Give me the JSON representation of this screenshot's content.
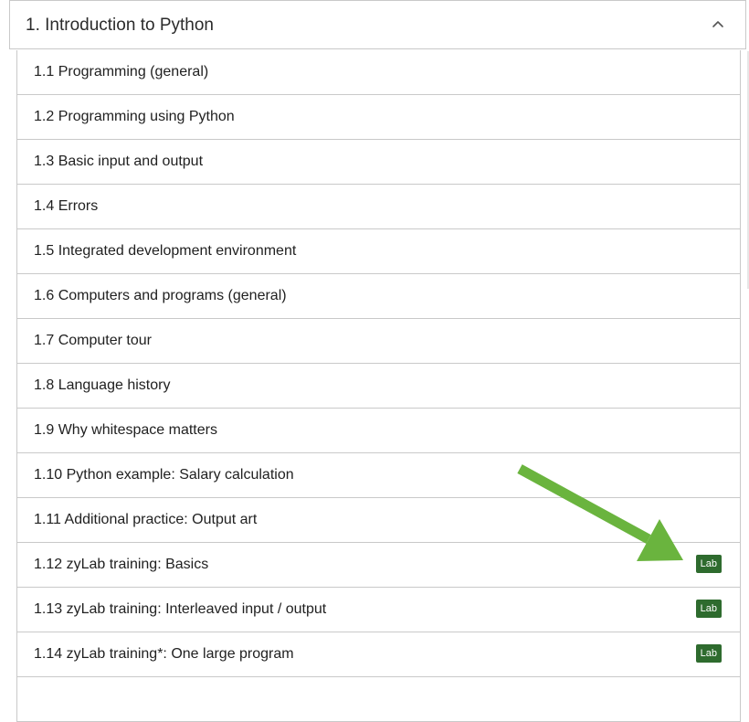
{
  "chapter": {
    "title": "1. Introduction to Python",
    "expanded": true,
    "toggle_icon": "chevron-up-icon"
  },
  "sections": [
    {
      "label": "1.1 Programming (general)",
      "badge": ""
    },
    {
      "label": "1.2 Programming using Python",
      "badge": ""
    },
    {
      "label": "1.3 Basic input and output",
      "badge": ""
    },
    {
      "label": "1.4 Errors",
      "badge": ""
    },
    {
      "label": "1.5 Integrated development environment",
      "badge": ""
    },
    {
      "label": "1.6 Computers and programs (general)",
      "badge": ""
    },
    {
      "label": "1.7 Computer tour",
      "badge": ""
    },
    {
      "label": "1.8 Language history",
      "badge": ""
    },
    {
      "label": "1.9 Why whitespace matters",
      "badge": ""
    },
    {
      "label": "1.10 Python example: Salary calculation",
      "badge": ""
    },
    {
      "label": "1.11 Additional practice: Output art",
      "badge": ""
    },
    {
      "label": "1.12 zyLab training: Basics",
      "badge": "Lab"
    },
    {
      "label": "1.13 zyLab training: Interleaved input / output",
      "badge": "Lab"
    },
    {
      "label": "1.14 zyLab training*: One large program",
      "badge": "Lab"
    },
    {
      "label": "",
      "badge": ""
    }
  ],
  "colors": {
    "border": "#c9c9c9",
    "lab_badge_bg": "#2e6b2e",
    "annotation_arrow": "#6ab43e"
  },
  "annotation": {
    "icon": "arrow-icon",
    "points_to": "1.12 zyLab training: Basics lab badge"
  }
}
